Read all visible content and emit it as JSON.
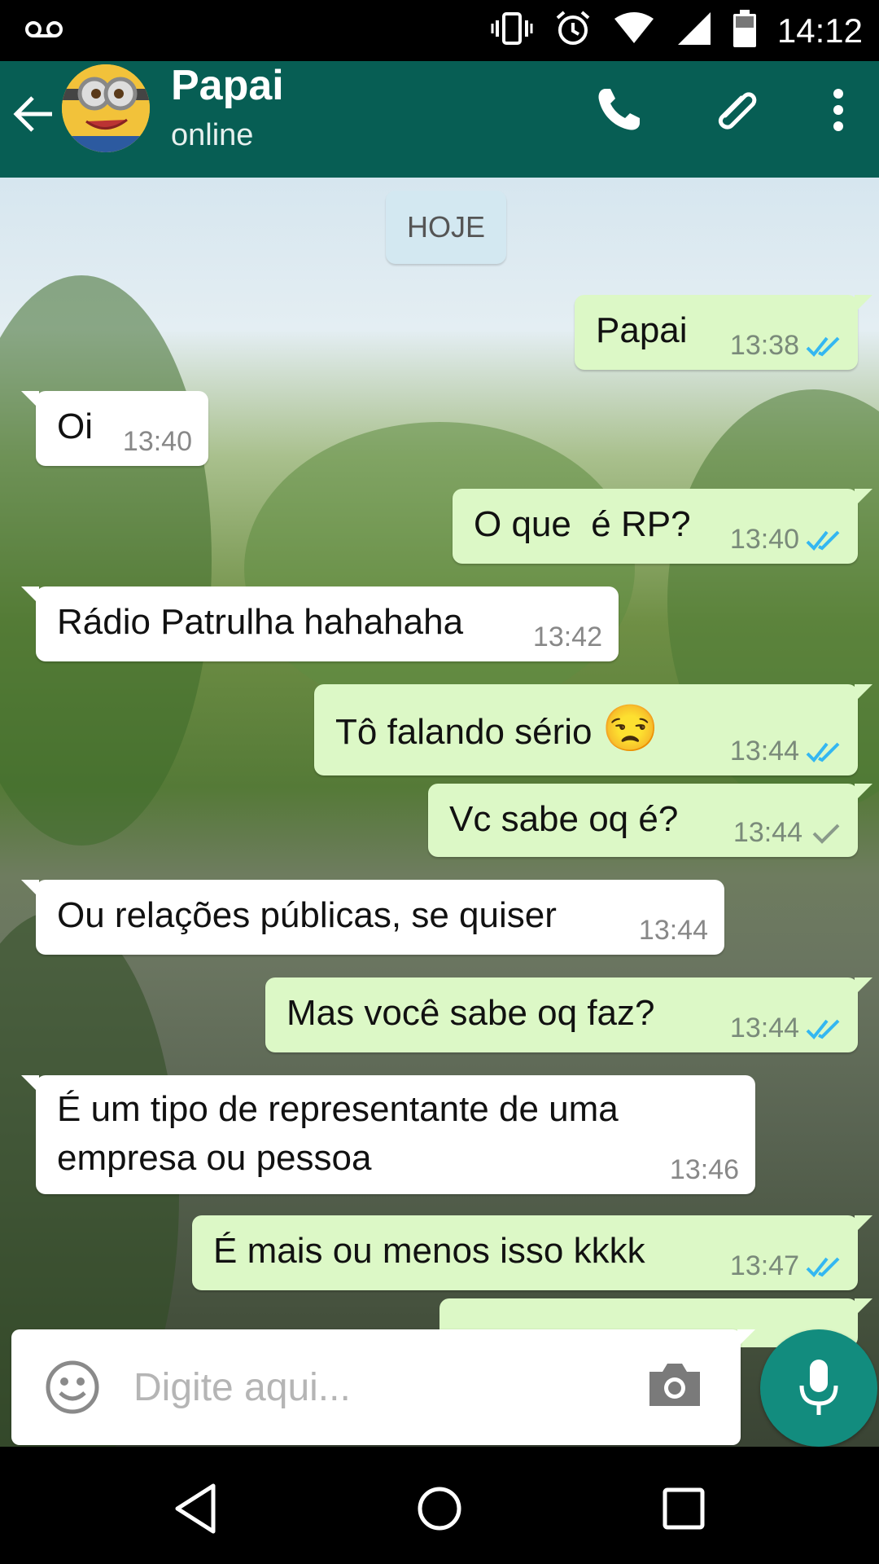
{
  "status_bar": {
    "time": "14:12",
    "icons": [
      "voicemail-icon",
      "vibrate-icon",
      "alarm-icon",
      "wifi-icon",
      "signal-icon",
      "battery-icon"
    ]
  },
  "header": {
    "contact_name": "Papai",
    "contact_status": "online",
    "icons": [
      "back-arrow-icon",
      "phone-icon",
      "attach-icon",
      "more-options-icon"
    ]
  },
  "chat": {
    "day_label": "HOJE",
    "messages": [
      {
        "dir": "out",
        "text": "Papai",
        "time": "13:38",
        "ticks": "double-blue"
      },
      {
        "dir": "in",
        "text": "Oi",
        "time": "13:40"
      },
      {
        "dir": "out",
        "text": "O que  é RP?",
        "time": "13:40",
        "ticks": "double-blue"
      },
      {
        "dir": "in",
        "text": "Rádio Patrulha hahahaha",
        "time": "13:42"
      },
      {
        "dir": "out",
        "text": "Tô falando sério",
        "emoji": "😒",
        "time": "13:44",
        "ticks": "double-blue"
      },
      {
        "dir": "out",
        "text": "Vc sabe oq é?",
        "time": "13:44",
        "ticks": "single-grey"
      },
      {
        "dir": "in",
        "text": "Ou relações públicas, se quiser",
        "time": "13:44"
      },
      {
        "dir": "out",
        "text": "Mas você sabe oq faz?",
        "time": "13:44",
        "ticks": "double-blue"
      },
      {
        "dir": "in",
        "text_line1": "É um tipo de representante de uma",
        "text_line2": "empresa ou pessoa",
        "time": "13:46"
      },
      {
        "dir": "out",
        "text": "É mais ou menos isso kkkk",
        "time": "13:47",
        "ticks": "double-blue"
      }
    ]
  },
  "compose": {
    "placeholder": "Digite aqui...",
    "icons": [
      "emoji-icon",
      "camera-icon",
      "microphone-icon"
    ]
  },
  "colors": {
    "header": "#075e54",
    "outgoing": "#dcf8c6",
    "incoming": "#ffffff",
    "tick_blue": "#34b7f1",
    "fab": "#128c7e"
  },
  "nav_bar": {
    "icons": [
      "back-triangle-icon",
      "home-circle-icon",
      "recents-square-icon"
    ]
  }
}
